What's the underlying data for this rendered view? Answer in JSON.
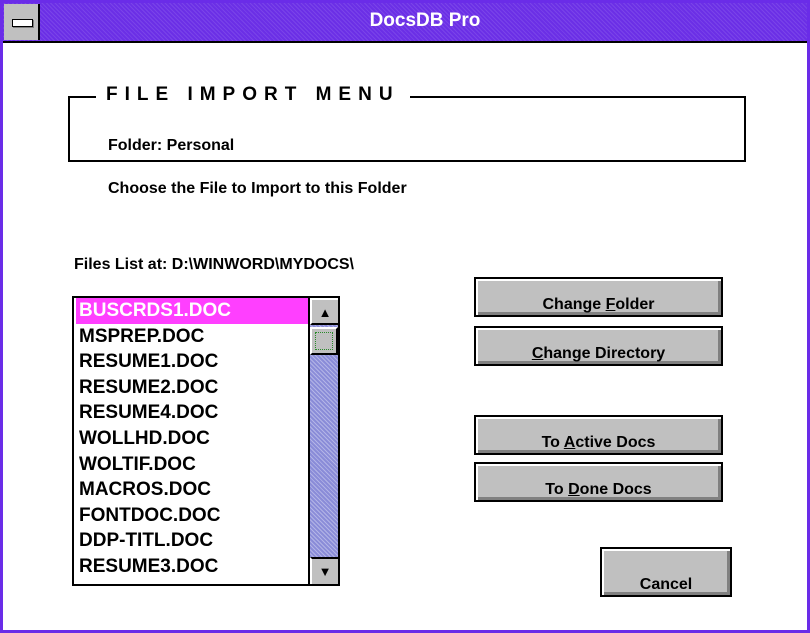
{
  "window": {
    "title": "DocsDB Pro",
    "accent_color": "#6b2fe6",
    "system_menu_icon": "system-menu-icon"
  },
  "group": {
    "title": "FILE IMPORT MENU",
    "folder_label": "Folder: Personal"
  },
  "instruction": "Choose the File to Import to this Folder",
  "files_path_label": "Files List at: D:\\WINWORD\\MYDOCS\\",
  "file_list": {
    "selected_index": 0,
    "selected_color": "#ff3fff",
    "items": [
      "BUSCRDS1.DOC",
      "MSPREP.DOC",
      "RESUME1.DOC",
      "RESUME2.DOC",
      "RESUME4.DOC",
      "WOLLHD.DOC",
      "WOLTIF.DOC",
      "MACROS.DOC",
      "FONTDOC.DOC",
      "DDP-TITL.DOC",
      "RESUME3.DOC"
    ],
    "scroll_up_icon": "arrow-up-icon",
    "scroll_down_icon": "arrow-down-icon"
  },
  "buttons": {
    "change_folder": {
      "pre": "Change ",
      "accel": "F",
      "post": "older"
    },
    "change_directory": {
      "pre": "",
      "accel": "C",
      "post": "hange Directory"
    },
    "to_active_docs": {
      "pre": "To ",
      "accel": "A",
      "post": "ctive Docs"
    },
    "to_done_docs": {
      "pre": "To ",
      "accel": "D",
      "post": "one Docs"
    },
    "cancel": {
      "pre": "Cancel",
      "accel": "",
      "post": ""
    }
  }
}
